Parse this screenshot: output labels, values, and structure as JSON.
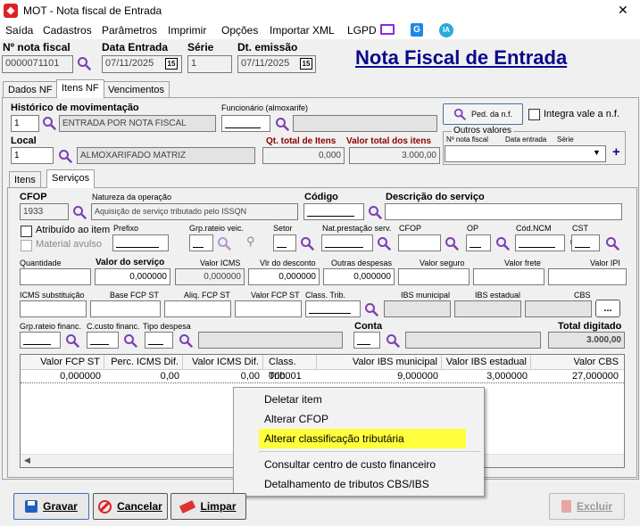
{
  "window": {
    "title": "MOT - Nota fiscal de Entrada",
    "close": "✕"
  },
  "menubar": [
    "Saída",
    "Cadastros",
    "Parâmetros",
    "Imprimir",
    "Opções",
    "Importar XML",
    "LGPD"
  ],
  "menubar_ia": "IA",
  "header": {
    "nota_label": "Nº nota fiscal",
    "nota_value": "0000071101",
    "entrada_label": "Data Entrada",
    "entrada_value": "07/11/2025",
    "serie_label": "Série",
    "serie_value": "1",
    "emissao_label": "Dt. emissão",
    "emissao_value": "07/11/2025",
    "cal_text": "15",
    "page_title": "Nota Fiscal de Entrada"
  },
  "tabs": [
    "Dados NF",
    "Itens NF",
    "Vencimentos"
  ],
  "itens_nf": {
    "historico_label": "Histórico de movimentação",
    "historico_code": "1",
    "historico_value": "ENTRADA POR NOTA FISCAL",
    "funcionario_label": "Funcionário (almoxarife)",
    "ped_button": "Ped. da n.f.",
    "integra_label": "Integra vale a n.f.",
    "local_label": "Local",
    "local_code": "1",
    "local_value": "ALMOXARIFADO MATRIZ",
    "qt_total_label": "Qt. total de Itens",
    "qt_total_value": "0,000",
    "valor_total_label": "Valor total dos itens",
    "valor_total_value": "3.000,00",
    "outros_valores": {
      "legend": "Outros valores",
      "col1": "Nº nota fiscal",
      "col2": "Data entrada",
      "col3": "Série",
      "add": "+"
    }
  },
  "subtabs": [
    "Itens",
    "Serviços"
  ],
  "servicos": {
    "cfop_label": "CFOP",
    "cfop_value": "1933",
    "natureza_label": "Natureza da operação",
    "natureza_value": "Aquisição de serviço tributado pelo ISSQN",
    "codigo_label": "Código",
    "descricao_label": "Descrição do serviço",
    "atribuido_label": "Atribuído ao item",
    "material_label": "Material avulso",
    "prefixo_label": "Prefixo",
    "grp_rateio_veic_label": "Grp.rateio veic.",
    "setor_label": "Setor",
    "nat_prest_label": "Nat.prestação serv.",
    "cfop2_label": "CFOP",
    "op_label": "OP",
    "ncm_label": "Cód.NCM",
    "cst_label": "CST",
    "quantidade_label": "Quantidade",
    "valor_servico_label": "Valor do serviço",
    "valor_servico_value": "0,000000",
    "valor_icms_label": "Valor ICMS",
    "valor_icms_value": "0,000000",
    "desconto_label": "Vlr do desconto",
    "desconto_value": "0,000000",
    "outras_label": "Outras despesas",
    "outras_value": "0,000000",
    "seguro_label": "Valor seguro",
    "frete_label": "Valor frete",
    "ipi_label": "Valor IPI",
    "icms_subst_label": "ICMS substituição",
    "base_fcp_label": "Base FCP ST",
    "aliq_fcp_label": "Aliq. FCP ST",
    "valor_fcp_label": "Valor FCP ST",
    "class_trib_label": "Class. Trib.",
    "ibs_mun_label": "IBS municipal",
    "ibs_est_label": "IBS estadual",
    "cbs_label": "CBS",
    "ellipsis": "...",
    "grp_rateio_fin_label": "Grp.rateio financ.",
    "custo_fin_label": "C.custo financ.",
    "tipo_despesa_label": "Tipo despesa",
    "conta_label": "Conta",
    "total_digitado_label": "Total digitado",
    "total_digitado_value": "3.000,00"
  },
  "grid": {
    "columns": [
      "Valor FCP ST",
      "Perc. ICMS Dif.",
      "Valor ICMS Dif.",
      "Class. Trib.",
      "Valor IBS municipal",
      "Valor IBS estadual",
      "Valor CBS"
    ],
    "rows": [
      [
        "0,000000",
        "0,00",
        "0,00",
        "000001",
        "9,000000",
        "3,000000",
        "27,000000"
      ]
    ]
  },
  "context_menu": [
    "Deletar item",
    "Alterar CFOP",
    "Alterar classificação tributária",
    "Consultar centro de custo financeiro",
    "Detalhamento de tributos CBS/IBS"
  ],
  "footer": {
    "gravar": "Gravar",
    "cancelar": "Cancelar",
    "limpar": "Limpar",
    "excluir": "Excluir"
  },
  "colors": {
    "title_blue": "#0a0a8c",
    "label_red": "#8b0000",
    "highlight": "#ffff3c",
    "search_purple": "#7b3fb6"
  }
}
